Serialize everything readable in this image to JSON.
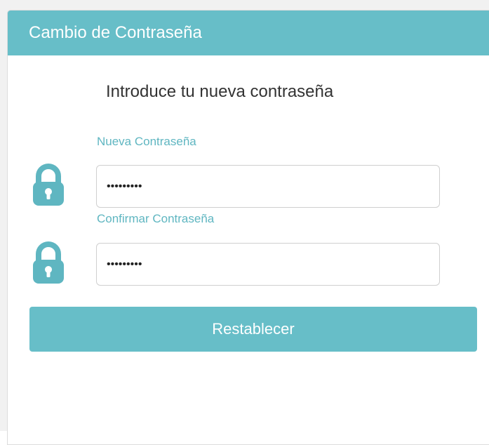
{
  "panel": {
    "title": "Cambio de Contraseña"
  },
  "form": {
    "instruction": "Introduce tu nueva contraseña",
    "new_password": {
      "label": "Nueva Contraseña",
      "value": "*********",
      "icon": "lock-icon"
    },
    "confirm_password": {
      "label": "Confirmar Contraseña",
      "value": "*********",
      "icon": "lock-icon"
    },
    "submit_label": "Restablecer"
  },
  "colors": {
    "accent": "#67bec8",
    "label": "#5fb6c1",
    "background": "#ffffff",
    "text": "#333333"
  }
}
